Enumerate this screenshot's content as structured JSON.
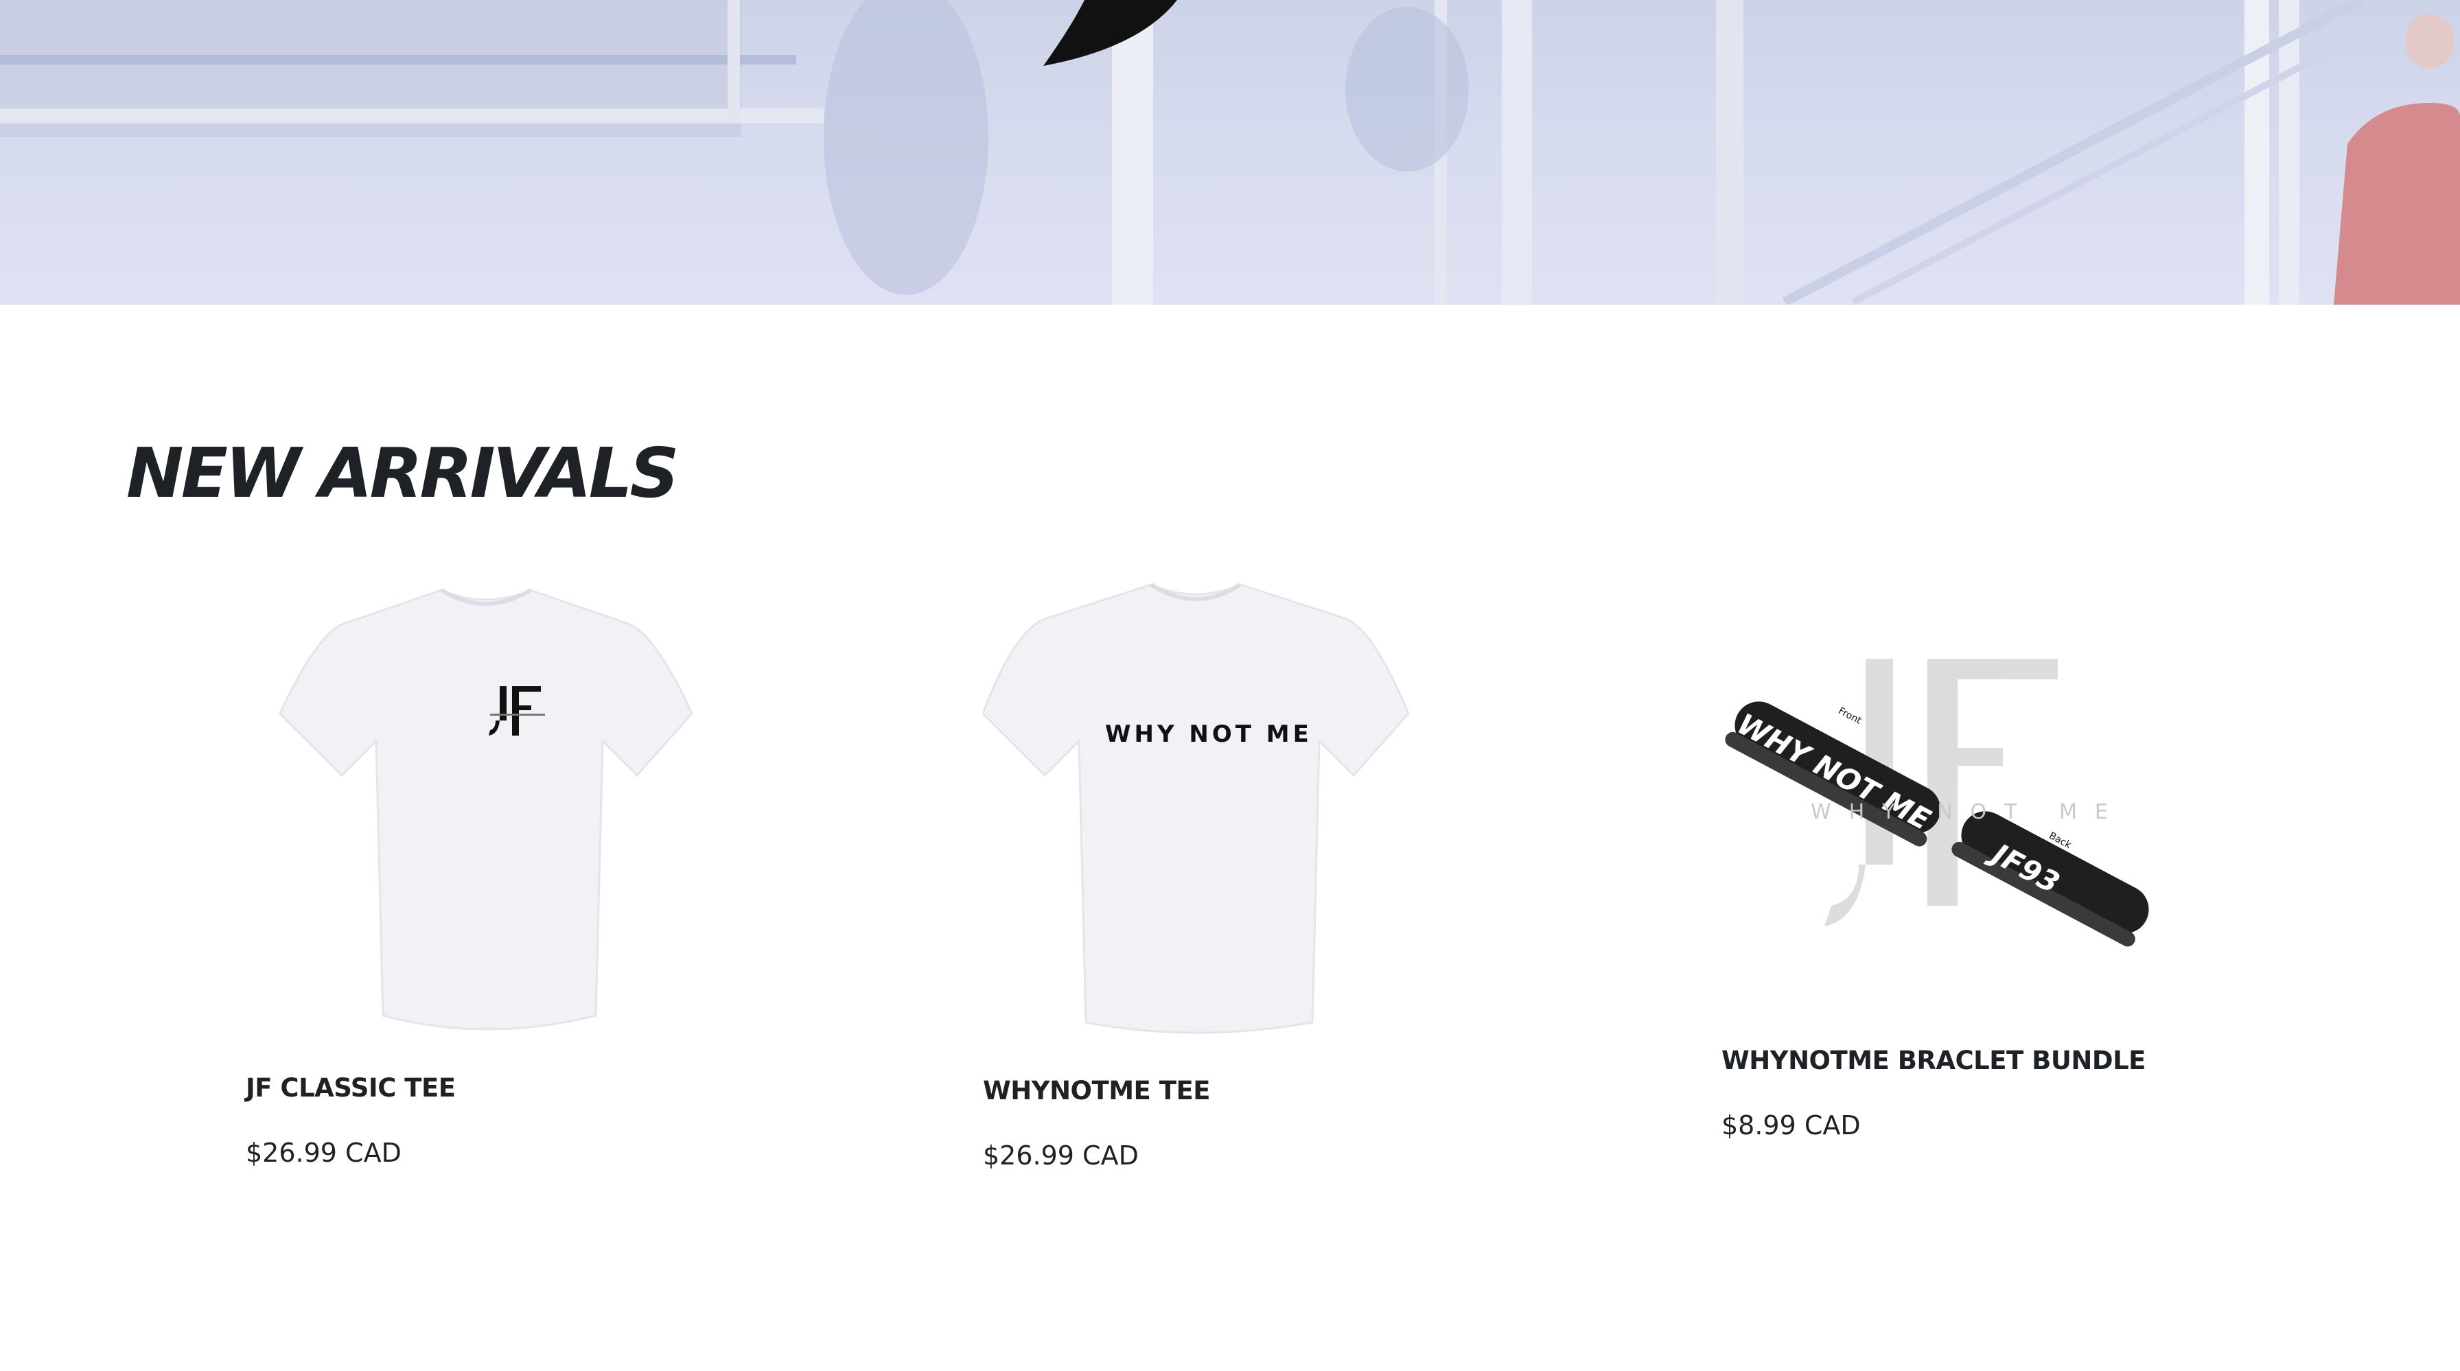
{
  "section": {
    "title": "NEW ARRIVALS"
  },
  "products": [
    {
      "name": "JF CLASSIC TEE",
      "price": "$26.99 CAD",
      "image": "white-tshirt-jf-logo"
    },
    {
      "name": "WHYNOTME TEE",
      "price": "$26.99 CAD",
      "image": "white-tshirt-why-not-me",
      "print_text": "WHY NOT ME"
    },
    {
      "name": "WHYNOTME BRACLET BUNDLE",
      "price": "$8.99 CAD",
      "image": "wristband-bundle",
      "band_front_text": "WHY NOT ME",
      "band_back_text": "JF93",
      "front_label": "Front",
      "back_label": "Back",
      "watermark_text": "WHY NOT ME"
    }
  ],
  "colors": {
    "text": "#1e2126",
    "hero_tint": "#d6dbee",
    "band": "#2a2a2a"
  }
}
